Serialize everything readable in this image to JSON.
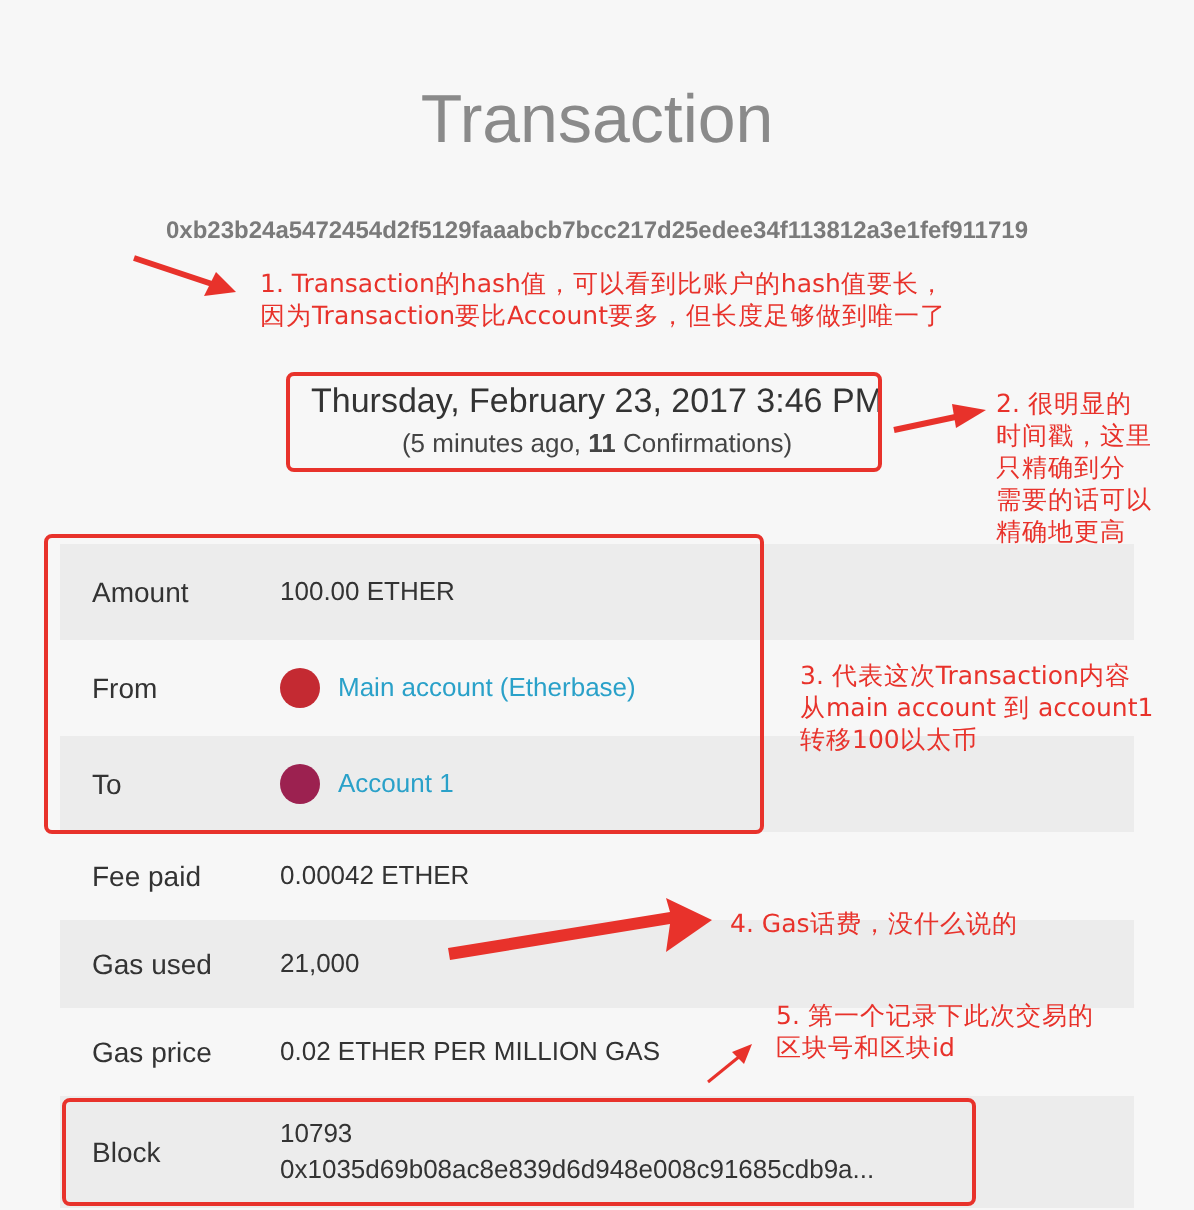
{
  "title": "Transaction",
  "hash": "0xb23b24a5472454d2f5129faaabcb7bcc217d25edee34f113812a3e1fef911719",
  "timestamp": {
    "date": "Thursday, February 23, 2017 3:46 PM",
    "relative": "(5 minutes ago, **11** Confirmations)"
  },
  "rows": [
    {
      "label": "Amount",
      "kind": "text",
      "value": "100.00 ETHER"
    },
    {
      "label": "From",
      "kind": "account",
      "value": "Main account (Etherbase)",
      "color": "#c42a32"
    },
    {
      "label": "To",
      "kind": "account",
      "value": "Account 1",
      "color": "#9c2150"
    },
    {
      "label": "Fee paid",
      "kind": "text",
      "value": "0.00042 ETHER"
    },
    {
      "label": "Gas used",
      "kind": "text",
      "value": "21,000"
    },
    {
      "label": "Gas price",
      "kind": "text",
      "value": "0.02 ETHER PER MILLION GAS"
    },
    {
      "label": "Block",
      "kind": "block",
      "value": "10793",
      "hash": "0x1035d69b08ac8e839d6d948e008c91685cdb9a..."
    }
  ],
  "annotations": [
    {
      "lines": [
        "1. Transaction的hash值，可以看到比账户的hash值要长，",
        "因为Transaction要比Account要多，但长度足够做到唯一了"
      ]
    },
    {
      "lines": [
        "2. 很明显的",
        "时间戳，这里",
        "只精确到分",
        "需要的话可以",
        "精确地更高"
      ]
    },
    {
      "lines": [
        "3. 代表这次Transaction内容",
        "从main account 到 account1",
        "转移100以太币"
      ]
    },
    {
      "lines": [
        "4. Gas话费，没什么说的"
      ]
    },
    {
      "lines": [
        "5. 第一个记录下此次交易的",
        "区块号和区块id"
      ]
    }
  ]
}
